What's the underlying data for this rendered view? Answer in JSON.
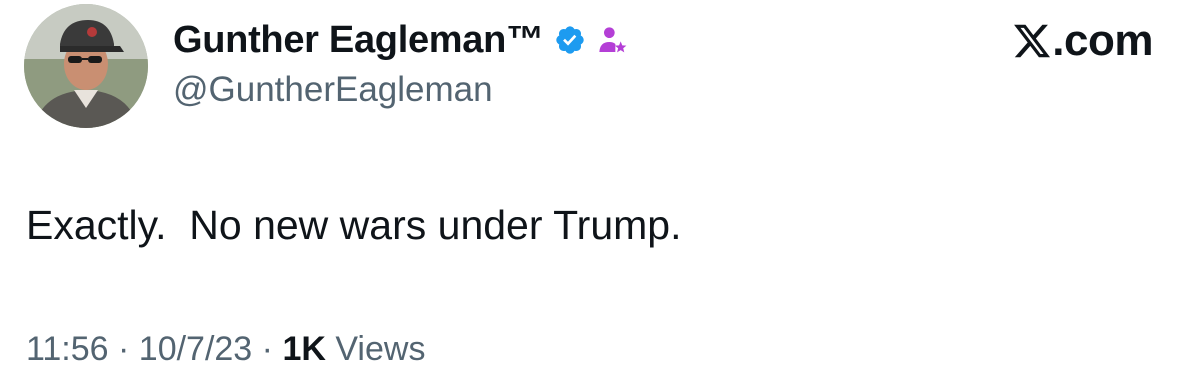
{
  "author": {
    "display_name": "Gunther Eagleman™",
    "handle": "@GuntherEagleman",
    "verified_icon": "verified-badge-icon",
    "affiliate_icon": "affiliate-icon",
    "verified_color": "#1d9bf0",
    "affiliate_color": "#b43fd6"
  },
  "brand": {
    "logo_icon": "x-logo-icon",
    "domain": ".com"
  },
  "tweet": {
    "text": "Exactly.  No new wars under Trump.",
    "time": "11:56",
    "separator1": " · ",
    "date": "10/7/23",
    "separator2": " · ",
    "views_count": "1K",
    "views_label": " Views"
  }
}
